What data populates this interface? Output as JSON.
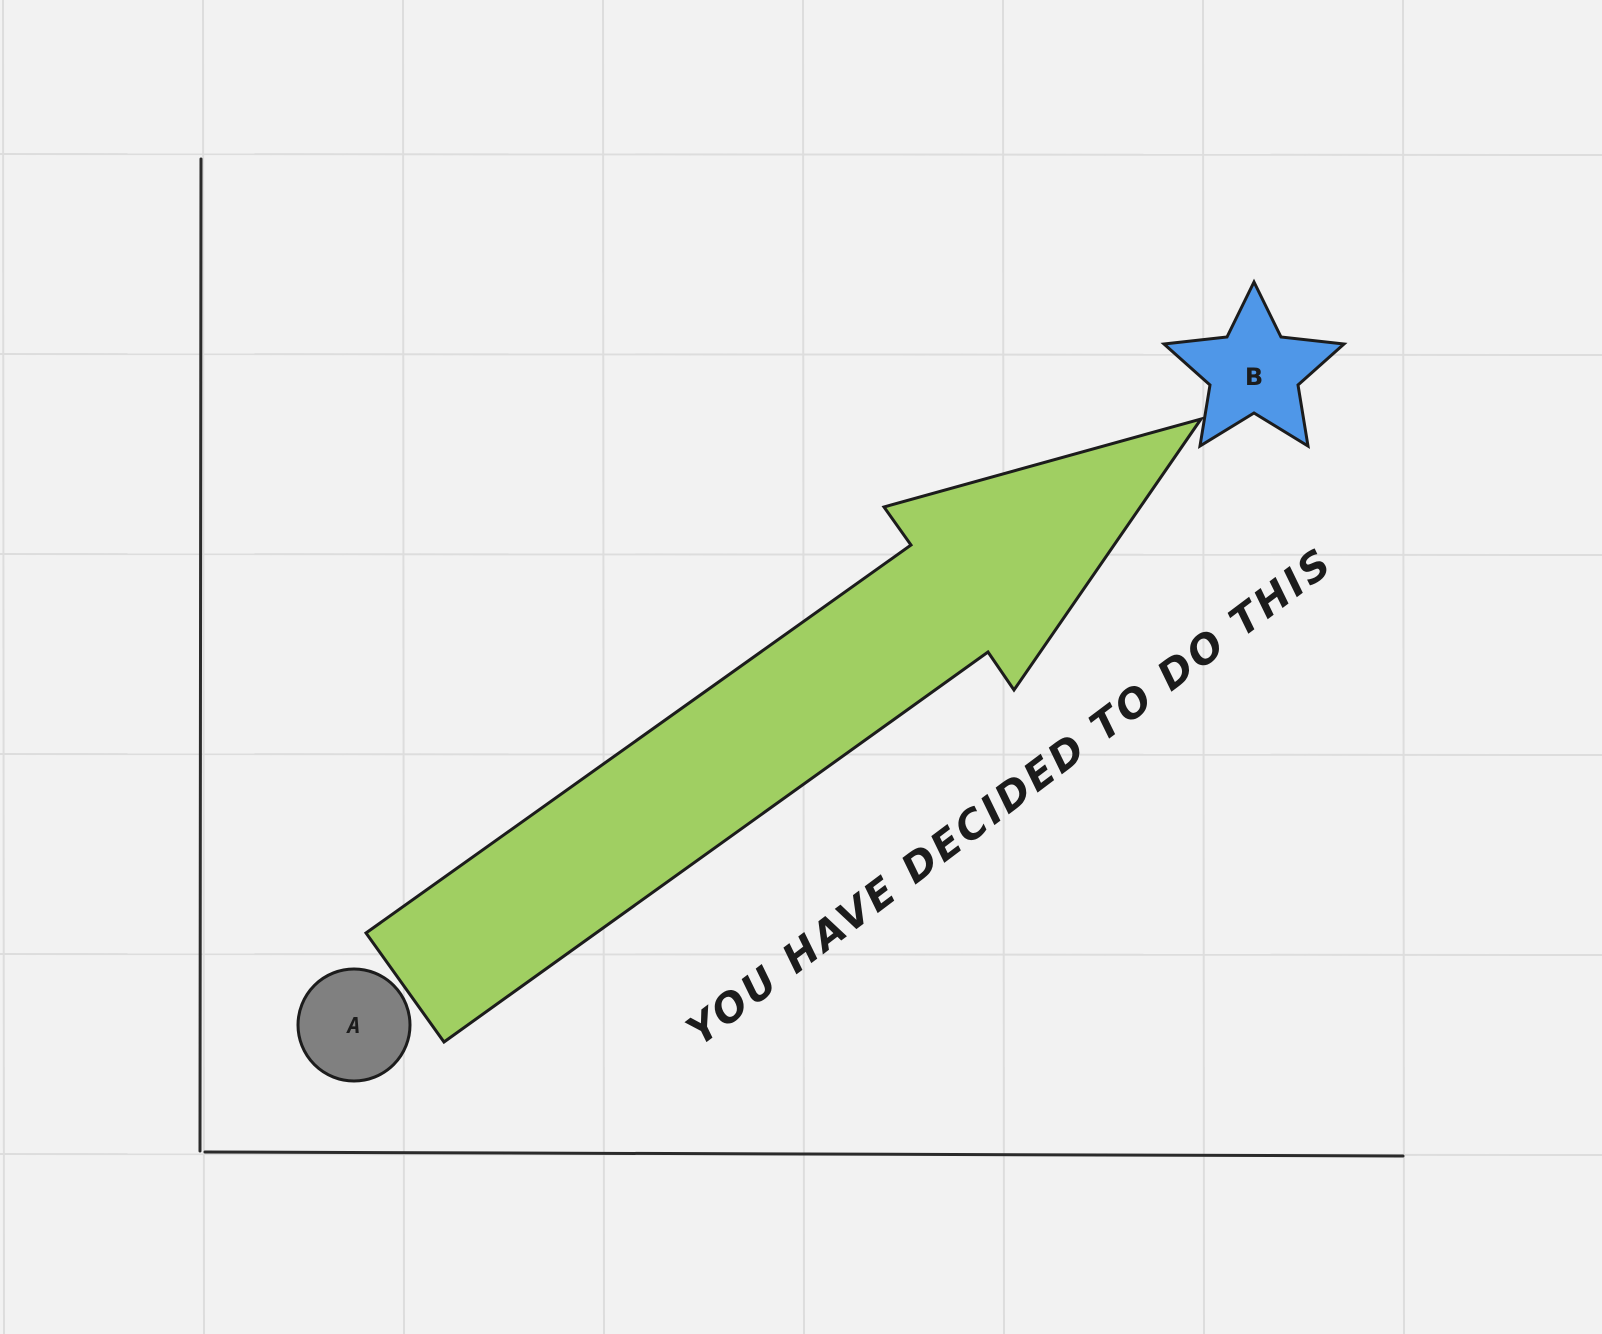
{
  "colors": {
    "background": "#f2f2f2",
    "grid": "#dddddd",
    "axis": "#2b2b2b",
    "arrow_fill": "#a0cf62",
    "start_node_fill": "#808080",
    "end_node_fill": "#4f97e8",
    "outline": "#1c1c1c"
  },
  "nodes": {
    "start": {
      "label": "A",
      "shape": "circle"
    },
    "end": {
      "label": "B",
      "shape": "star"
    }
  },
  "arrow": {
    "direction": "from A to B"
  },
  "annotation": {
    "text": "YOU HAVE DECIDED TO DO THIS"
  }
}
